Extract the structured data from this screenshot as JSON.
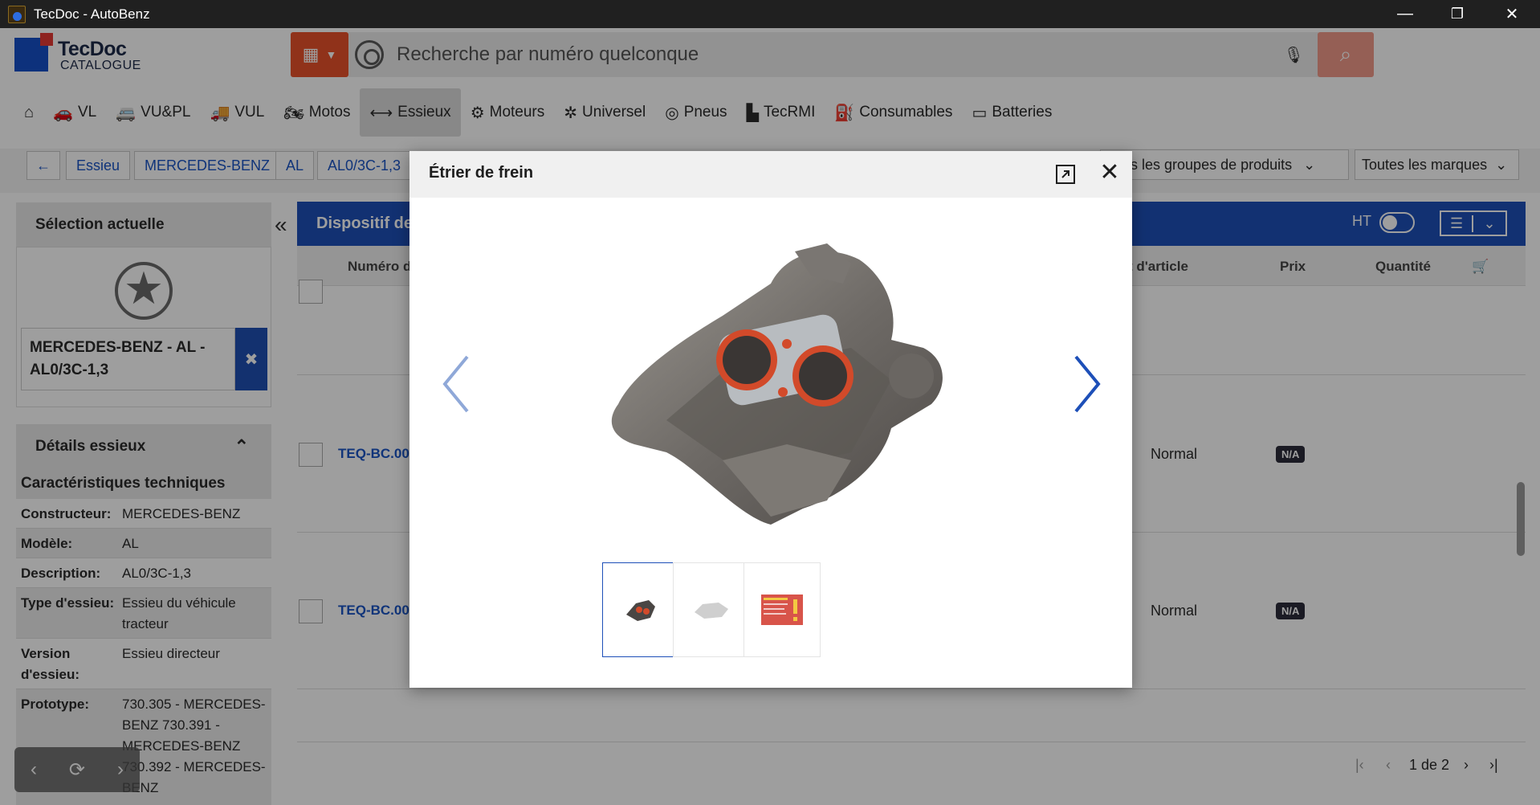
{
  "window": {
    "title": "TecDoc - AutoBenz",
    "minimize": "—",
    "maximize": "❐",
    "close": "✕"
  },
  "brand": {
    "title": "TecDoc",
    "subtitle": "CATALOGUE"
  },
  "search": {
    "placeholder": "Recherche par numéro quelconque",
    "grid_icon": "grid-icon",
    "mic_icon": "mic-icon",
    "go_icon": "search-icon"
  },
  "nav": [
    {
      "label": "",
      "icon": "home-icon",
      "glyph": "⌂"
    },
    {
      "label": "VL",
      "icon": "car-icon",
      "glyph": "🚗"
    },
    {
      "label": "VU&PL",
      "icon": "van-icon",
      "glyph": "🚐"
    },
    {
      "label": "VUL",
      "icon": "truck-icon",
      "glyph": "🚚"
    },
    {
      "label": "Motos",
      "icon": "motorcycle-icon",
      "glyph": "🏍"
    },
    {
      "label": "Essieux",
      "icon": "axle-icon",
      "glyph": "⟷",
      "active": true
    },
    {
      "label": "Moteurs",
      "icon": "engine-icon",
      "glyph": "⚙"
    },
    {
      "label": "Universel",
      "icon": "universal-icon",
      "glyph": "✲"
    },
    {
      "label": "Pneus",
      "icon": "tire-icon",
      "glyph": "◎"
    },
    {
      "label": "TecRMI",
      "icon": "tecrmi-icon",
      "glyph": "▙"
    },
    {
      "label": "Consumables",
      "icon": "consumables-icon",
      "glyph": "⛽"
    },
    {
      "label": "Batteries",
      "icon": "battery-icon",
      "glyph": "▭"
    }
  ],
  "breadcrumb": {
    "back": "←",
    "items": [
      "Essieu",
      "MERCEDES-BENZ",
      "AL",
      "AL0/3C-1,3"
    ]
  },
  "filters": {
    "groups": "Tous les groupes de produits",
    "brands": "Toutes les marques",
    "chevron": "⌄"
  },
  "selection": {
    "title": "Sélection actuelle",
    "collapse": "«",
    "vehicle": "MERCEDES-BENZ - AL - AL0/3C-1,3",
    "remove": "✖"
  },
  "details": {
    "title": "Détails essieux",
    "toggle": "⌃",
    "section": "Caractéristiques techniques",
    "rows": [
      {
        "k": "Constructeur:",
        "v": "MERCEDES-BENZ"
      },
      {
        "k": "Modèle:",
        "v": "AL"
      },
      {
        "k": "Description:",
        "v": "AL0/3C-1,3"
      },
      {
        "k": "Type d'essieu:",
        "v": "Essieu du véhicule tracteur"
      },
      {
        "k": "Version d'essieu:",
        "v": "Essieu directeur"
      },
      {
        "k": "Prototype:",
        "v": "730.305 - MERCEDES-BENZ 730.391 - MERCEDES-BENZ 730.392 - MERCEDES-BENZ"
      }
    ]
  },
  "float_controls": {
    "prev": "‹",
    "refresh": "⟳",
    "next": "›"
  },
  "results": {
    "bar_title": "Dispositif de",
    "ht_label": "HT",
    "list_icon": "☰",
    "chevron": "⌄",
    "columns": [
      "Numéro d",
      "t d'article",
      "Prix",
      "Quantité"
    ],
    "cart_icon": "🛒",
    "rows": [
      {
        "number": "TEQ-BC.00",
        "status": "Normal",
        "price": "N/A"
      },
      {
        "number": "TEQ-BC.00",
        "status": "Normal",
        "price": "N/A"
      }
    ],
    "pager": {
      "first": "|‹",
      "prev": "‹",
      "label": "1 de 2",
      "next": "›",
      "last": "›|"
    }
  },
  "modal": {
    "title": "Étrier de frein",
    "expand_icon": "expand-icon",
    "close_icon": "close-icon",
    "close": "✕",
    "thumbnails": 3,
    "selected_thumbnail": 1
  }
}
